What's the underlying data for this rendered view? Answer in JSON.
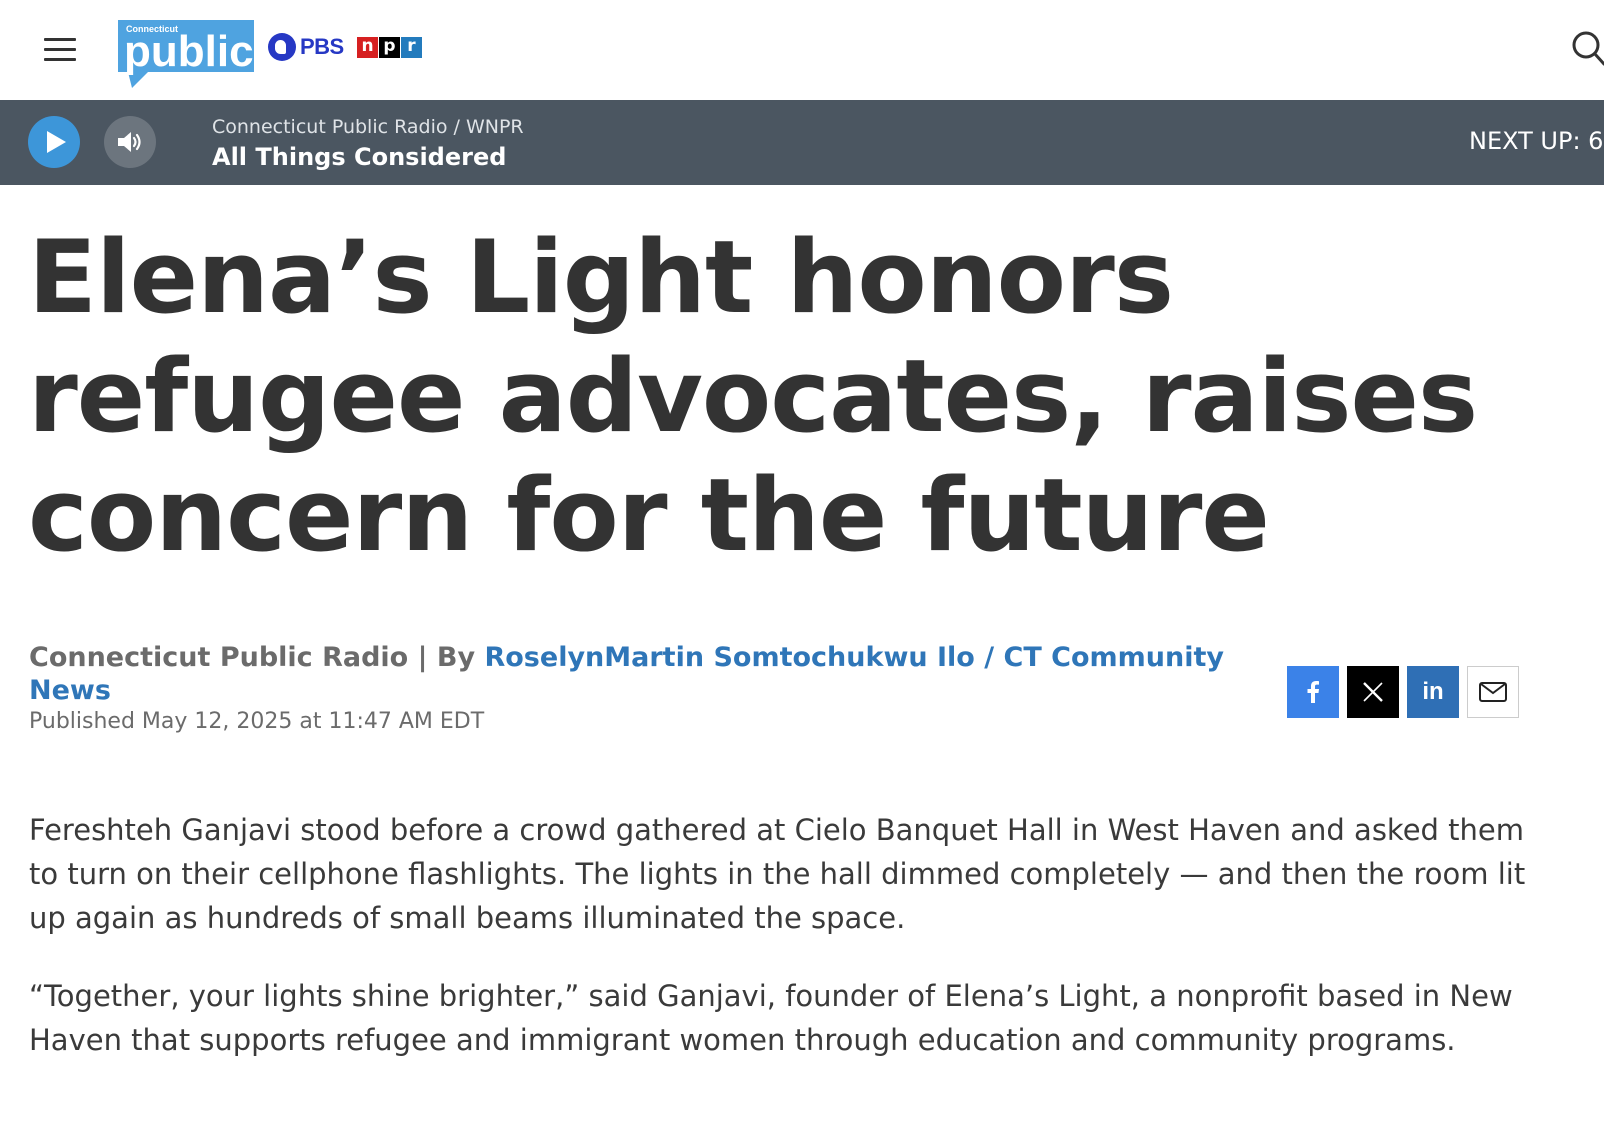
{
  "header": {
    "logo_text": "Connecticut public",
    "pbs_label": "PBS",
    "npr_letters": [
      "n",
      "p",
      "r"
    ],
    "menu_icon": "hamburger-menu-icon",
    "search_icon": "search-icon",
    "brand_colors": {
      "ct_public_blue": "#4fa3e0",
      "pbs_blue": "#2638c4",
      "npr_red": "#d62021",
      "npr_black": "#000000",
      "npr_blue": "#237bbd"
    }
  },
  "player": {
    "station": "Connecticut Public Radio / WNPR",
    "program": "All Things Considered",
    "next_up": "NEXT UP: 6",
    "play_icon": "play-icon",
    "volume_icon": "volume-icon",
    "bar_color": "#4b5661",
    "play_color": "#3d96d9"
  },
  "article": {
    "headline": "Elena’s Light honors refugee advocates, raises concern for the future",
    "byline_prefix": "Connecticut Public Radio | By ",
    "author": "RoselynMartin Somtochukwu Ilo / CT Community News",
    "published": "Published May 12, 2025 at 11:47 AM EDT",
    "share": {
      "facebook_icon": "facebook-icon",
      "x_icon": "x-icon",
      "linkedin_label": "in",
      "email_icon": "email-icon"
    },
    "paragraphs": [
      "Fereshteh Ganjavi stood before a crowd gathered at Cielo Banquet Hall in West Haven and asked them to turn on their cellphone flashlights. The lights in the hall dimmed completely — and then the room lit up again as hundreds of small beams illuminated the space.",
      "“Together, your lights shine brighter,” said Ganjavi, founder of Elena’s Light, a nonprofit based in New Haven that supports refugee and immigrant women through education and community programs."
    ]
  }
}
